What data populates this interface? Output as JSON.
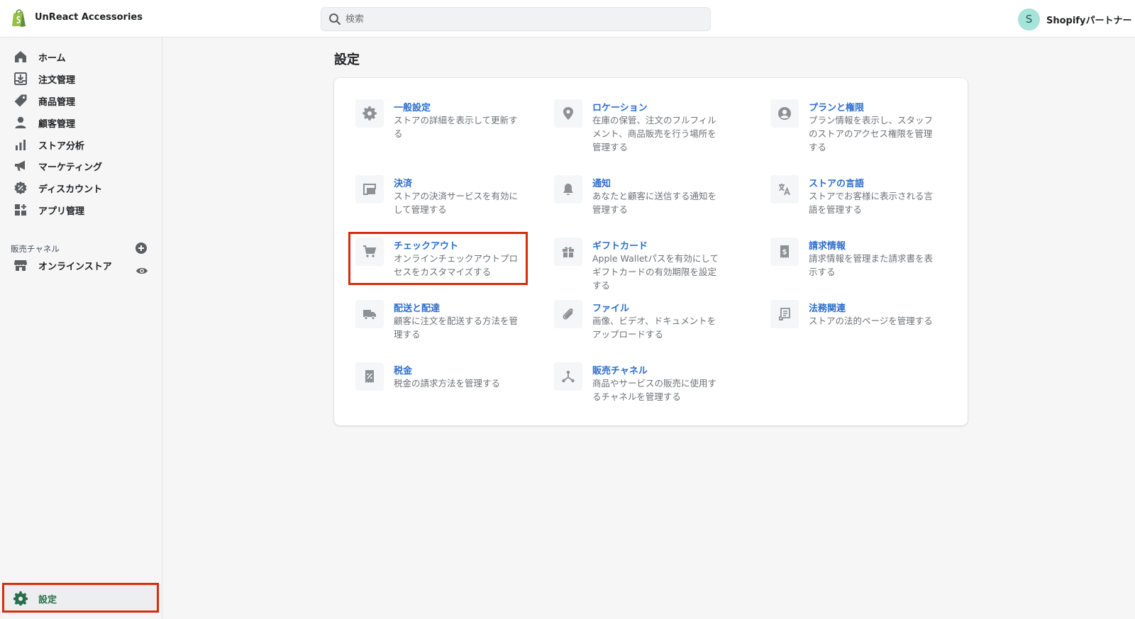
{
  "topbar": {
    "store_name": "UnReact Accessories",
    "search_placeholder": "検索",
    "user_initial": "S",
    "user_name": "Shopifyパートナー"
  },
  "sidebar": {
    "items": [
      {
        "label": "ホーム",
        "icon": "home-icon"
      },
      {
        "label": "注文管理",
        "icon": "orders-icon"
      },
      {
        "label": "商品管理",
        "icon": "tag-icon"
      },
      {
        "label": "顧客管理",
        "icon": "customer-icon"
      },
      {
        "label": "ストア分析",
        "icon": "analytics-icon"
      },
      {
        "label": "マーケティング",
        "icon": "megaphone-icon"
      },
      {
        "label": "ディスカウント",
        "icon": "discount-icon"
      },
      {
        "label": "アプリ管理",
        "icon": "apps-icon"
      }
    ],
    "channels_heading": "販売チャネル",
    "channels": [
      {
        "label": "オンラインストア",
        "icon": "store-icon"
      }
    ],
    "settings_label": "設定"
  },
  "main": {
    "title": "設定",
    "settings": [
      {
        "title": "一般設定",
        "desc": "ストアの詳細を表示して更新する",
        "icon": "gear-icon"
      },
      {
        "title": "ロケーション",
        "desc": "在庫の保管、注文のフルフィルメント、商品販売を行う場所を管理する",
        "icon": "location-pin-icon"
      },
      {
        "title": "プランと権限",
        "desc": "プラン情報を表示し、スタッフのストアのアクセス権限を管理する",
        "icon": "user-circle-icon"
      },
      {
        "title": "決済",
        "desc": "ストアの決済サービスを有効にして管理する",
        "icon": "payment-card-icon"
      },
      {
        "title": "通知",
        "desc": "あなたと顧客に送信する通知を管理する",
        "icon": "bell-icon"
      },
      {
        "title": "ストアの言語",
        "desc": "ストアでお客様に表示される言語を管理する",
        "icon": "translate-icon"
      },
      {
        "title": "チェックアウト",
        "desc": "オンラインチェックアウトプロセスをカスタマイズする",
        "icon": "cart-icon"
      },
      {
        "title": "ギフトカード",
        "desc": "Apple Walletパスを有効にしてギフトカードの有効期限を設定する",
        "icon": "gift-icon"
      },
      {
        "title": "請求情報",
        "desc": "請求情報を管理また請求書を表示する",
        "icon": "billing-icon"
      },
      {
        "title": "配送と配達",
        "desc": "顧客に注文を配送する方法を管理する",
        "icon": "truck-icon"
      },
      {
        "title": "ファイル",
        "desc": "画像、ビデオ、ドキュメントをアップロードする",
        "icon": "paperclip-icon"
      },
      {
        "title": "法務関連",
        "desc": "ストアの法的ページを管理する",
        "icon": "legal-document-icon"
      },
      {
        "title": "税金",
        "desc": "税金の請求方法を管理する",
        "icon": "tax-icon"
      },
      {
        "title": "販売チャネル",
        "desc": "商品やサービスの販売に使用するチャネルを管理する",
        "icon": "channels-icon"
      }
    ]
  },
  "colors": {
    "accent_link": "#2c6ecb",
    "highlight": "#d82c0d",
    "settings_active": "#2a6f4d"
  }
}
